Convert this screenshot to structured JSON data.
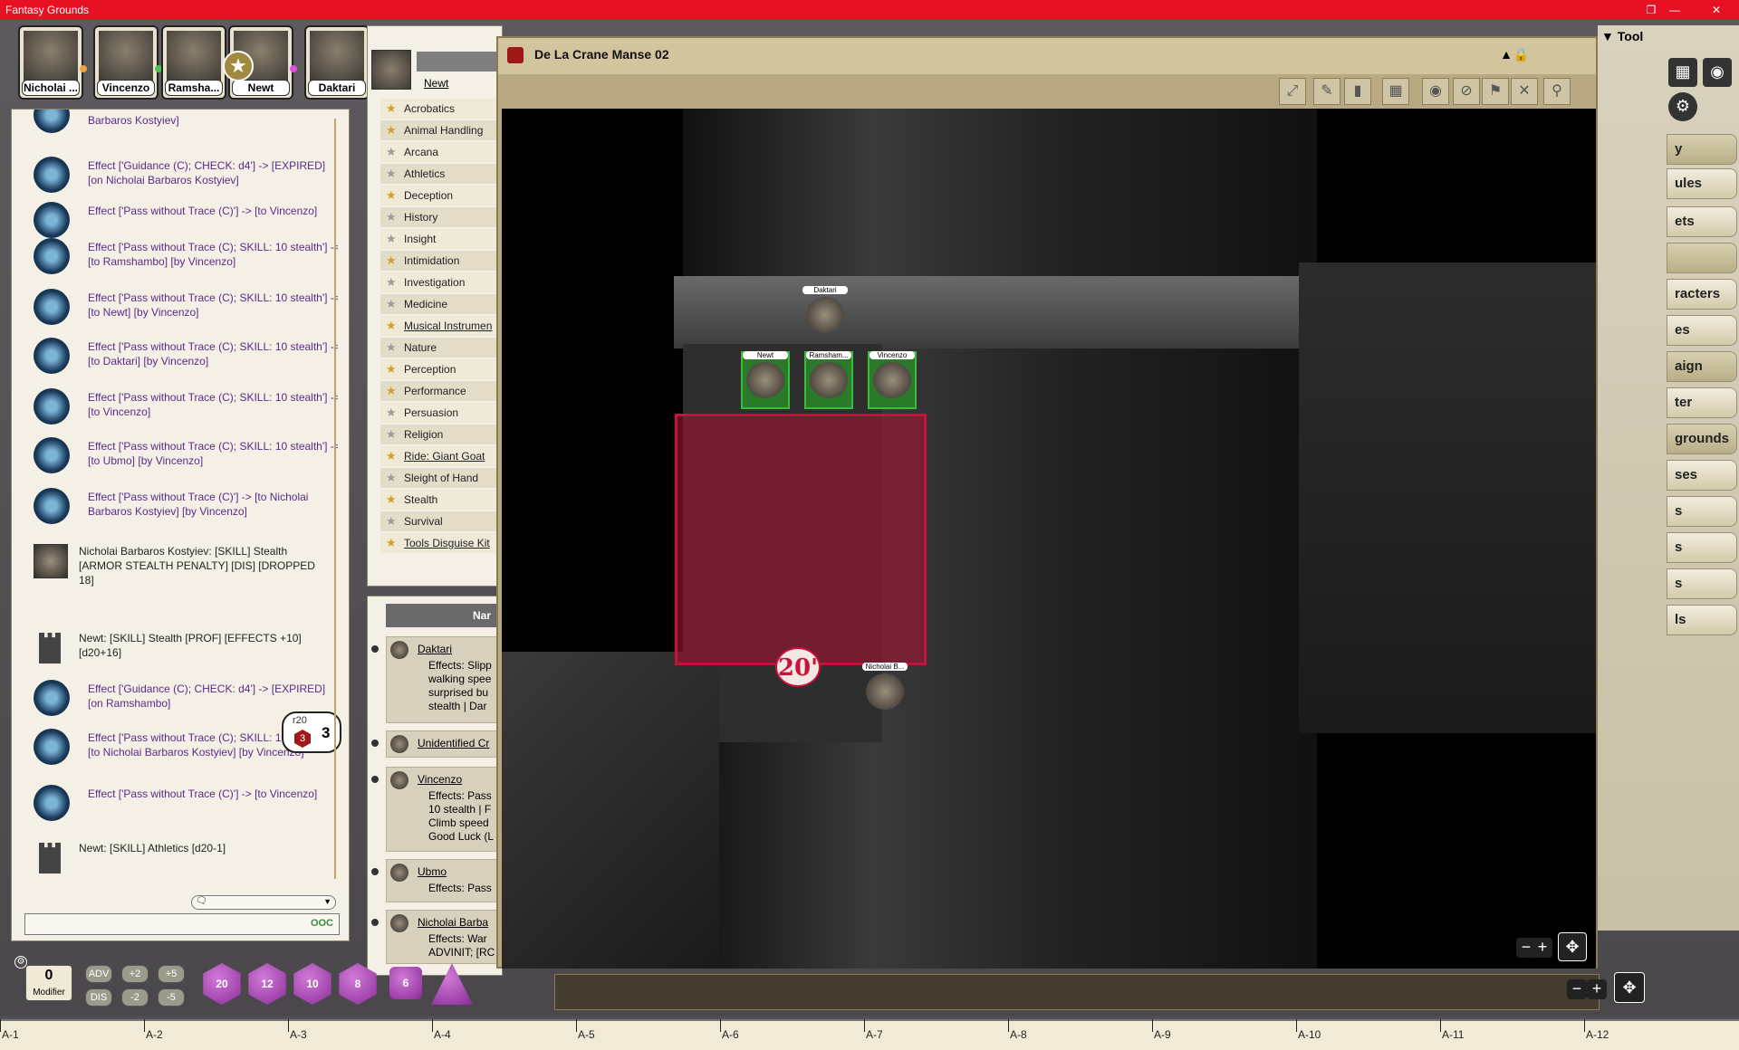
{
  "window": {
    "title": "Fantasy Grounds"
  },
  "party": [
    {
      "name": "Nicholai ...",
      "dot": "#f0a040"
    },
    {
      "name": "Vincenzo",
      "dot": "#50c050"
    },
    {
      "name": "Ramsha...",
      "dot": ""
    },
    {
      "name": "Newt",
      "dot": "#e050e0"
    },
    {
      "name": "Daktari",
      "dot": ""
    }
  ],
  "chat": {
    "messages": [
      {
        "text": "Barbaros Kostyiev]"
      },
      {
        "text": "Effect ['Guidance (C); CHECK: d4'] -> [EXPIRED] [on Nicholai Barbaros Kostyiev]"
      },
      {
        "text": "Effect ['Pass without Trace (C)'] -> [to Vincenzo]"
      },
      {
        "text": "Effect ['Pass without Trace (C); SKILL: 10 stealth'] -> [to Ramshambo] [by Vincenzo]"
      },
      {
        "text": "Effect ['Pass without Trace (C); SKILL: 10 stealth'] -> [to Newt] [by Vincenzo]"
      },
      {
        "text": "Effect ['Pass without Trace (C); SKILL: 10 stealth'] -> [to Daktari] [by Vincenzo]"
      },
      {
        "text": "Effect ['Pass without Trace (C); SKILL: 10 stealth'] -> [to Vincenzo]"
      },
      {
        "text": "Effect ['Pass without Trace (C); SKILL: 10 stealth'] -> [to Ubmo] [by Vincenzo]"
      },
      {
        "text": "Effect ['Pass without Trace (C)'] -> [to Nicholai Barbaros Kostyiev] [by Vincenzo]"
      },
      {
        "text": "Nicholai Barbaros Kostyiev: [SKILL] Stealth [ARMOR STEALTH PENALTY] [DIS] [DROPPED 18]"
      },
      {
        "text": "Newt: [SKILL] Stealth [PROF] [EFFECTS +10] [d20+16]"
      },
      {
        "text": "Effect ['Guidance (C); CHECK: d4'] -> [EXPIRED] [on Ramshambo]"
      },
      {
        "text": "Effect ['Pass without Trace (C); SKILL: 10 stealth'] -> [to Nicholai Barbaros Kostyiev] [by Vincenzo]"
      },
      {
        "text": "Effect ['Pass without Trace (C)'] -> [to Vincenzo]"
      },
      {
        "text": "Newt:   [SKILL] Athletics [d20-1]"
      }
    ],
    "roll": {
      "die": "r20",
      "die_value": "3",
      "total": "3"
    },
    "ooc": "OOC"
  },
  "skills": {
    "tab": "Newt",
    "items": [
      {
        "label": "Acrobatics",
        "prof": true
      },
      {
        "label": "Animal Handling",
        "prof": true
      },
      {
        "label": "Arcana",
        "prof": false
      },
      {
        "label": "Athletics",
        "prof": false
      },
      {
        "label": "Deception",
        "prof": true
      },
      {
        "label": "History",
        "prof": false
      },
      {
        "label": "Insight",
        "prof": false
      },
      {
        "label": "Intimidation",
        "prof": true
      },
      {
        "label": "Investigation",
        "prof": false
      },
      {
        "label": "Medicine",
        "prof": false
      },
      {
        "label": "Musical Instrumen",
        "prof": true,
        "link": true
      },
      {
        "label": "Nature",
        "prof": false
      },
      {
        "label": "Perception",
        "prof": true
      },
      {
        "label": "Performance",
        "prof": true
      },
      {
        "label": "Persuasion",
        "prof": false
      },
      {
        "label": "Religion",
        "prof": false
      },
      {
        "label": "Ride: Giant Goat",
        "prof": true,
        "link": true
      },
      {
        "label": "Sleight of Hand",
        "prof": false
      },
      {
        "label": "Stealth",
        "prof": true
      },
      {
        "label": "Survival",
        "prof": false
      },
      {
        "label": "Tools Disguise Kit",
        "prof": true,
        "link": true
      }
    ]
  },
  "combat": {
    "header": "Nar",
    "rows": [
      {
        "name": "Daktari",
        "text": "Effects: Slipp walking spee surprised bu stealth | Dar"
      },
      {
        "name": "Unidentified Cr",
        "text": ""
      },
      {
        "name": "Vincenzo",
        "text": "Effects: Pass 10 stealth | F Climb speed Good Luck (L"
      },
      {
        "name": "Ubmo",
        "text": "Effects: Pass"
      },
      {
        "name": "Nicholai Barba",
        "text": "Effects: War ADVINIT; [RC"
      }
    ]
  },
  "map": {
    "title": "De La Crane Manse 02",
    "area_label": "20'",
    "tokens": [
      {
        "name": "Daktari"
      },
      {
        "name": "Newt"
      },
      {
        "name": "Ramsham..."
      },
      {
        "name": "Vincenzo"
      },
      {
        "name": "Nicholai B..."
      }
    ]
  },
  "right_panel": {
    "header": "Tool",
    "buttons": [
      "y",
      "ules",
      "ets",
      "",
      "racters",
      "es",
      "aign",
      "ter",
      "grounds",
      "ses",
      "s",
      "s",
      "s",
      "ls"
    ]
  },
  "modifier": {
    "value": "0",
    "label": "Modifier",
    "buttons": [
      "ADV",
      "+2",
      "+5",
      "DIS",
      "-2",
      "-5"
    ]
  },
  "dice": [
    "20",
    "12",
    "10",
    "8",
    "6",
    ""
  ],
  "grid_labels": [
    "A-1",
    "A-2",
    "A-3",
    "A-4",
    "A-5",
    "A-6",
    "A-7",
    "A-8",
    "A-9",
    "A-10",
    "A-11",
    "A-12"
  ],
  "colors": {
    "titlebar": "#e81123",
    "effect_text": "#5a2a8a",
    "area": "#c8123a",
    "token_border": "#3bbd3b"
  }
}
